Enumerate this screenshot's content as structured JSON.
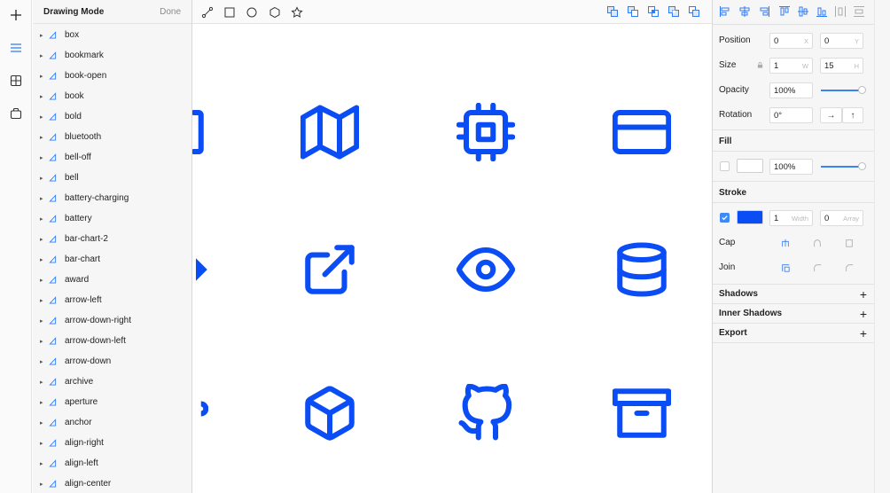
{
  "layers": {
    "title": "Drawing Mode",
    "done_label": "Done",
    "items": [
      "box",
      "bookmark",
      "book-open",
      "book",
      "bold",
      "bluetooth",
      "bell-off",
      "bell",
      "battery-charging",
      "battery",
      "bar-chart-2",
      "bar-chart",
      "award",
      "arrow-left",
      "arrow-down-right",
      "arrow-down-left",
      "arrow-down",
      "archive",
      "aperture",
      "anchor",
      "align-right",
      "align-left",
      "align-center"
    ]
  },
  "toolbar": {
    "icons": [
      "plus-icon",
      "menu-icon",
      "grid-icon",
      "bag-icon"
    ]
  },
  "topbar": {
    "tools": [
      "pen-tool-icon",
      "rectangle-icon",
      "ellipse-icon",
      "polygon-icon",
      "star-icon"
    ],
    "boolean_ops": [
      "union-icon",
      "subtract-icon",
      "intersect-icon",
      "difference-icon",
      "flatten-icon"
    ]
  },
  "canvas": {
    "icon_color": "#0b4df5",
    "icons": [
      "map-icon",
      "cpu-icon",
      "credit-card-icon",
      "external-link-icon",
      "eye-icon",
      "database-icon",
      "box-icon",
      "github-icon",
      "archive-icon"
    ]
  },
  "inspector": {
    "position_label": "Position",
    "position_x": "0",
    "position_y": "0",
    "x_unit": "X",
    "y_unit": "Y",
    "size_label": "Size",
    "size_w": "1",
    "size_h": "15",
    "w_unit": "W",
    "h_unit": "H",
    "opacity_label": "Opacity",
    "opacity_value": "100%",
    "opacity_level": 1.0,
    "rotation_label": "Rotation",
    "rotation_value": "0°",
    "flip_h": "→",
    "flip_v": "↑",
    "fill_title": "Fill",
    "fill_color": "#ffffff",
    "fill_opacity": "100%",
    "fill_opacity_level": 1.0,
    "stroke_title": "Stroke",
    "stroke_color": "#0b4df5",
    "stroke_width": "1",
    "width_unit": "Width",
    "dash_value": "0",
    "array_unit": "Array",
    "cap_label": "Cap",
    "join_label": "Join",
    "shadows_title": "Shadows",
    "inner_shadows_title": "Inner Shadows",
    "export_title": "Export",
    "plus": "+"
  }
}
